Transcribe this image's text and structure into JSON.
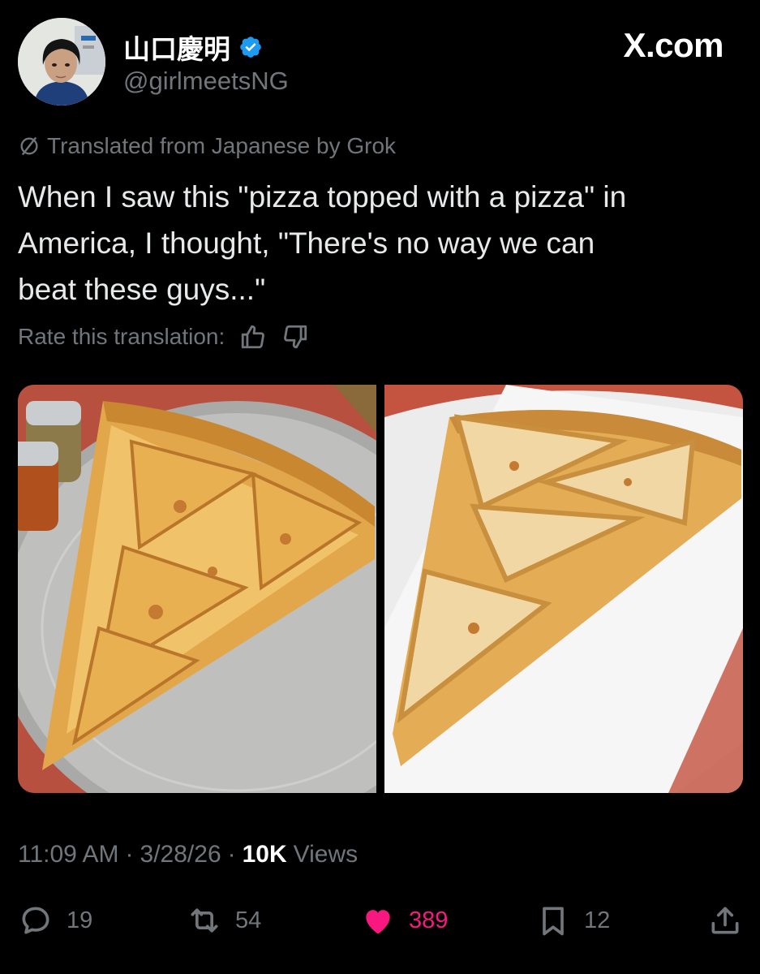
{
  "user": {
    "display_name": "山口慶明",
    "handle": "@girlmeetsNG",
    "verified": true
  },
  "brand": "X.com",
  "translation_note": "Translated from Japanese by Grok",
  "tweet_lines": [
    "When I saw this \"pizza topped with a pizza\" in",
    "America, I thought, \"There's no way we can",
    "beat these guys...\""
  ],
  "rate_label": "Rate this translation:",
  "meta": {
    "time": "11:09 AM",
    "date": "3/28/26",
    "views_count": "10K",
    "views_label": "Views",
    "separator": "·"
  },
  "actions": {
    "replies": "19",
    "reposts": "54",
    "likes": "389",
    "bookmarks": "12"
  },
  "colors": {
    "background": "#000000",
    "muted": "#71767b",
    "like": "#f91880",
    "verified": "#1d9bf0"
  },
  "icons": [
    "verified-badge-icon",
    "translate-icon",
    "thumbs-up-icon",
    "thumbs-down-icon",
    "reply-icon",
    "repost-icon",
    "heart-icon",
    "bookmark-icon",
    "share-icon"
  ]
}
